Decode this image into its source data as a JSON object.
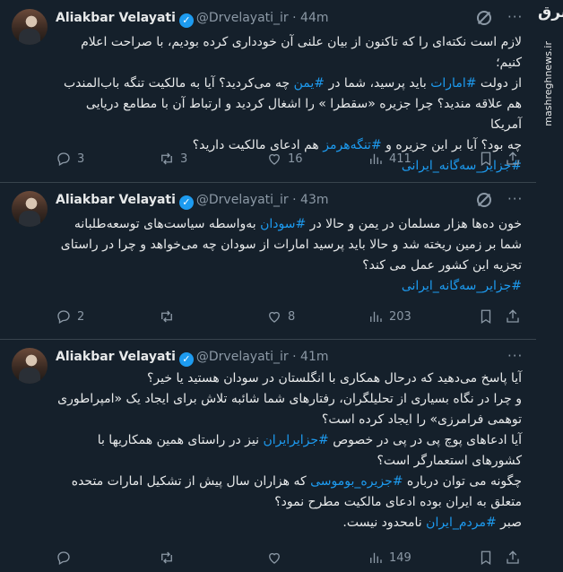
{
  "watermark": {
    "logo_text": "مشرق",
    "site": "mashreghnews.ir"
  },
  "tweets": [
    {
      "author": "Aliakbar Velayati",
      "handle": "@Drvelayati_ir",
      "time": "44m",
      "lines": [
        [
          {
            "t": "لازم است نکته‌ای را که تاکنون از بیان علنی آن خودداری کرده بودیم، با صراحت اعلام کنیم؛"
          }
        ],
        [
          {
            "t": "از دولت "
          },
          {
            "t": "#امارات",
            "link": true
          },
          {
            "t": " باید پرسید، شما در "
          },
          {
            "t": "#یمن",
            "link": true
          },
          {
            "t": " چه می‌کردید؟ آیا به مالکیت تنگه باب‌المندب"
          }
        ],
        [
          {
            "t": "هم علاقه مندید؟ چرا جزیره «سقطرا » را اشغال کردید و ارتباط آن با مطامع دریایی آمریکا"
          }
        ],
        [
          {
            "t": "چه بود؟ آیا بر این جزیره و "
          },
          {
            "t": "#تنگه‌هرمز",
            "link": true
          },
          {
            "t": " هم ادعای مالکیت دارید؟"
          }
        ],
        [
          {
            "t": "#جزایر_سه‌گانه_ایرانی",
            "link": true
          }
        ]
      ],
      "stats": {
        "replies": "3",
        "retweets": "3",
        "likes": "16",
        "views": "411"
      }
    },
    {
      "author": "Aliakbar Velayati",
      "handle": "@Drvelayati_ir",
      "time": "43m",
      "lines": [
        [
          {
            "t": "خون ده‌ها هزار مسلمان در یمن و حالا در "
          },
          {
            "t": "#سودان",
            "link": true
          },
          {
            "t": " به‌واسطه سیاست‌های توسعه‌طلبانه"
          }
        ],
        [
          {
            "t": "شما بر زمین ریخته شد و حالا باید پرسید امارات از سودان چه می‌خواهد و چرا در راستای"
          }
        ],
        [
          {
            "t": "تجزیه این کشور عمل می کند؟"
          }
        ],
        [
          {
            "t": "#جزایر_سه‌گانه_ایرانی",
            "link": true
          }
        ]
      ],
      "stats": {
        "replies": "2",
        "retweets": "",
        "likes": "8",
        "views": "203"
      }
    },
    {
      "author": "Aliakbar Velayati",
      "handle": "@Drvelayati_ir",
      "time": "41m",
      "lines": [
        [
          {
            "t": "آیا پاسخ می‌دهید که درحال همکاری با انگلستان در سودان هستید یا خیر؟"
          }
        ],
        [
          {
            "t": "و چرا در نگاه بسیاری از تحلیلگران، رفتارهای شما شائبه تلاش برای ایجاد یک «امپراطوری"
          }
        ],
        [
          {
            "t": "توهمی فرامرزی» را ایجاد کرده است؟"
          }
        ],
        [
          {
            "t": "آیا ادعاهای پوچ پی در پی در خصوص "
          },
          {
            "t": "#جزایرایران",
            "link": true
          },
          {
            "t": " نیز در راستای همین همکاریها با"
          }
        ],
        [
          {
            "t": "کشورهای استعمارگر است؟"
          }
        ],
        [
          {
            "t": "چگونه می توان درباره "
          },
          {
            "t": "#جزیره_بوموسی",
            "link": true
          },
          {
            "t": " که هزاران سال پیش از تشکیل امارات متحده"
          }
        ],
        [
          {
            "t": "متعلق به ایران بوده ادعای مالکیت مطرح نمود؟"
          }
        ],
        [
          {
            "t": "صبر "
          },
          {
            "t": "#مردم_ایران",
            "link": true
          },
          {
            "t": " نامحدود نیست."
          }
        ]
      ],
      "stats": {
        "replies": "",
        "retweets": "",
        "likes": "",
        "views": "149"
      }
    }
  ]
}
